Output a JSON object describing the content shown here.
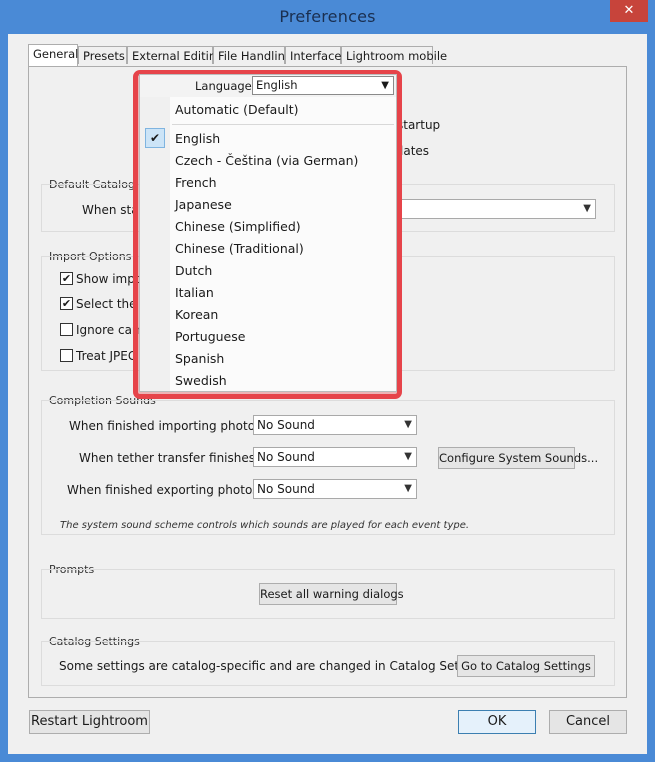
{
  "window": {
    "title": "Preferences",
    "close_glyph": "✕"
  },
  "tabs": [
    "General",
    "Presets",
    "External Editing",
    "File Handling",
    "Interface",
    "Lightroom mobile"
  ],
  "partial": {
    "startup": "startup",
    "updates": "lates"
  },
  "default_catalog": {
    "title": "Default Catalog",
    "label": "When startin"
  },
  "import_options": {
    "title": "Import Options",
    "items": [
      {
        "label": "Show import d",
        "checked": true
      },
      {
        "label": "Select the \"Cu",
        "checked": true
      },
      {
        "label": "Ignore camer",
        "checked": false
      },
      {
        "label": "Treat JPEG fil",
        "checked": false
      }
    ]
  },
  "completion_sounds": {
    "title": "Completion Sounds",
    "rows": [
      {
        "label": "When finished importing photos play:",
        "value": "No Sound"
      },
      {
        "label": "When tether transfer finishes play:",
        "value": "No Sound"
      },
      {
        "label": "When finished exporting photos play:",
        "value": "No Sound"
      }
    ],
    "config_button": "Configure System Sounds...",
    "note": "The system sound scheme controls which sounds are played for each event type."
  },
  "prompts": {
    "title": "Prompts",
    "reset_button": "Reset all warning dialogs"
  },
  "catalog_settings": {
    "title": "Catalog Settings",
    "text": "Some settings are catalog-specific and are changed in Catalog Settings.",
    "button": "Go to Catalog Settings"
  },
  "footer": {
    "restart": "Restart Lightroom",
    "ok": "OK",
    "cancel": "Cancel"
  },
  "language_popup": {
    "label": "Language:",
    "selected": "English",
    "check_glyph": "✔",
    "automatic": "Automatic (Default)",
    "options": [
      "English",
      "Czech - Čeština (via German)",
      "French",
      "Japanese",
      "Chinese (Simplified)",
      "Chinese (Traditional)",
      "Dutch",
      "Italian",
      "Korean",
      "Portuguese",
      "Spanish",
      "Swedish"
    ]
  },
  "colors": {
    "accent": "#4a8ad6",
    "highlight": "#e6444a",
    "close": "#c7443b"
  }
}
